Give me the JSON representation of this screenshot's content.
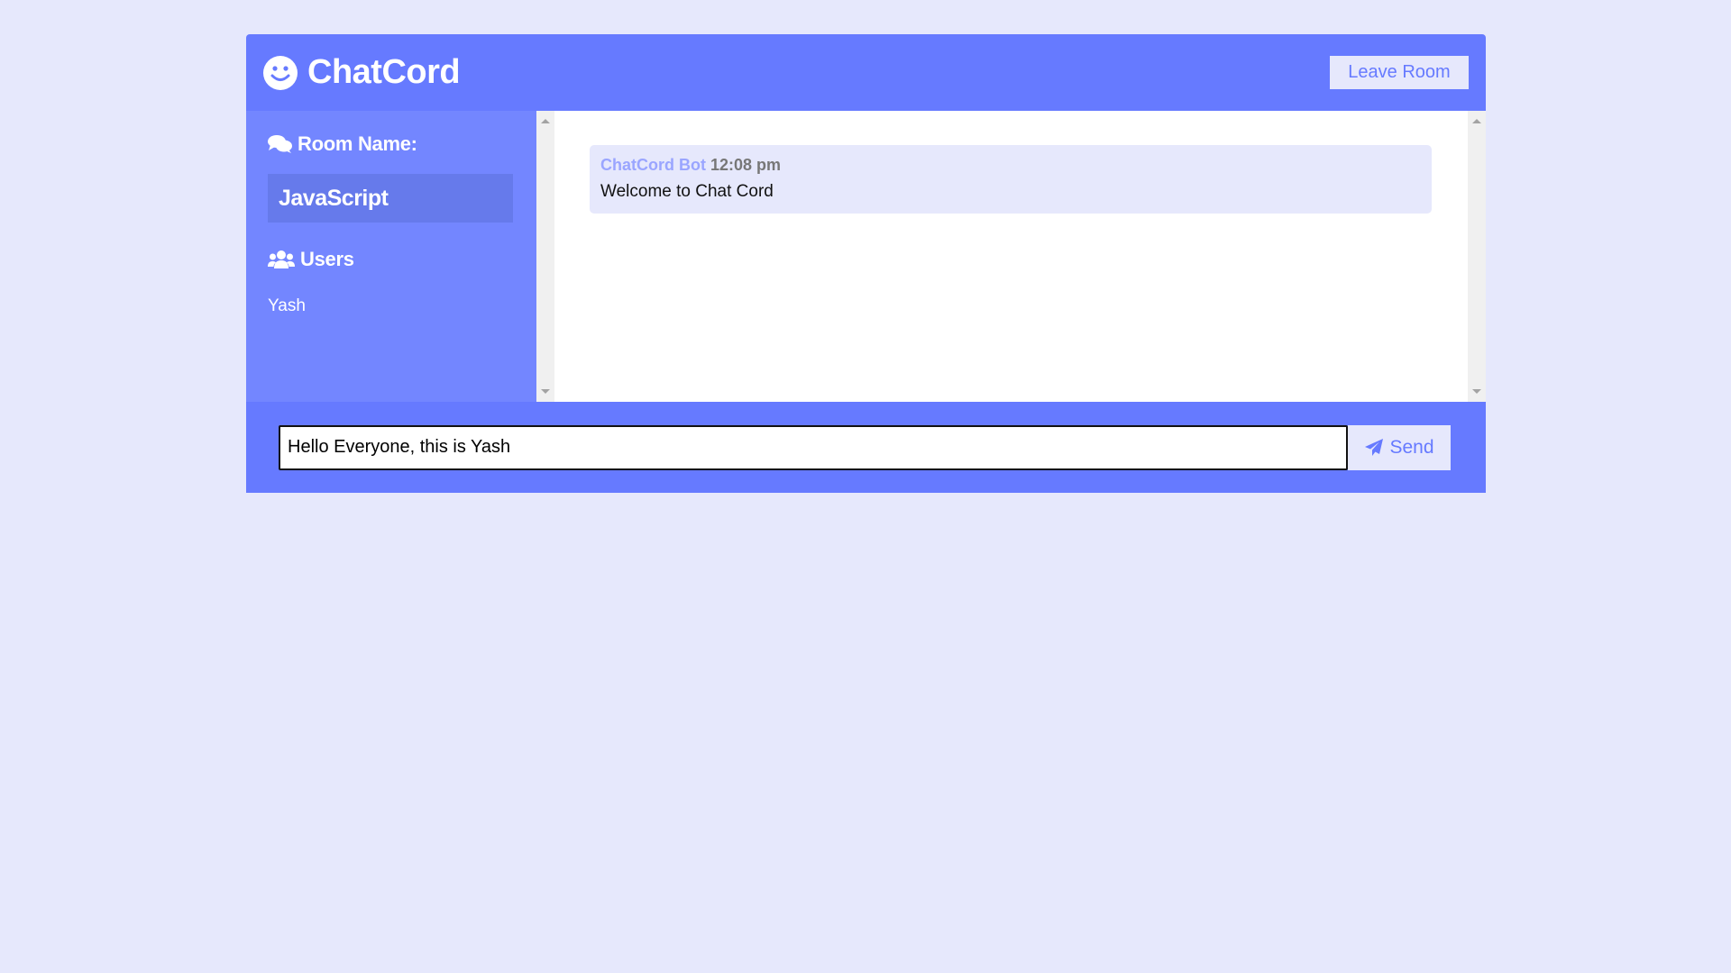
{
  "header": {
    "brand": "ChatCord",
    "leave_label": "Leave Room"
  },
  "sidebar": {
    "room_heading": "Room Name:",
    "room_name": "JavaScript",
    "users_heading": "Users",
    "users": [
      "Yash"
    ]
  },
  "messages": [
    {
      "author": "ChatCord Bot",
      "time": "12:08 pm",
      "text": "Welcome to Chat Cord"
    }
  ],
  "composer": {
    "value": "Hello Everyone, this is Yash",
    "send_label": "Send"
  },
  "colors": {
    "background": "#e6e8fc",
    "primary": "#667aff",
    "sidebar": "#7386ff",
    "room_highlight": "#667aeb"
  },
  "icons": {
    "brand": "smile-icon",
    "room": "comments-icon",
    "users": "users-icon",
    "send": "paper-plane-icon"
  }
}
